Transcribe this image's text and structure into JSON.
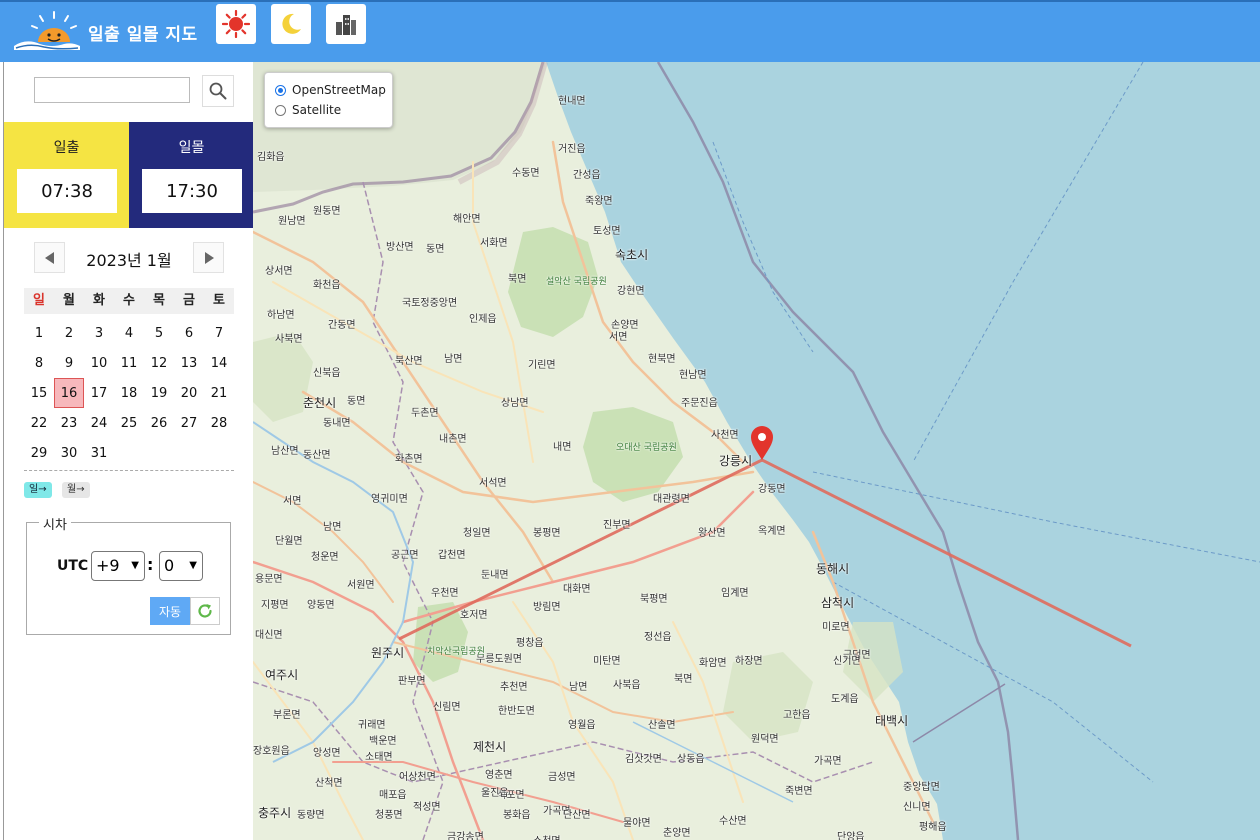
{
  "app": {
    "title": "일출 일몰 지도"
  },
  "header": {
    "icons": [
      "sun-icon",
      "moon-icon",
      "buildings-icon"
    ]
  },
  "search": {
    "placeholder": ""
  },
  "sun": {
    "sunrise_label": "일출",
    "sunrise_time": "07:38",
    "sunset_label": "일몰",
    "sunset_time": "17:30"
  },
  "calendar": {
    "month_title": "2023년 1월",
    "weekdays": [
      "일",
      "월",
      "화",
      "수",
      "목",
      "금",
      "토"
    ],
    "leading_blanks": 0,
    "days": [
      1,
      2,
      3,
      4,
      5,
      6,
      7,
      8,
      9,
      10,
      11,
      12,
      13,
      14,
      15,
      16,
      17,
      18,
      19,
      20,
      21,
      22,
      23,
      24,
      25,
      26,
      27,
      28,
      29,
      30,
      31
    ],
    "selected_day": 16,
    "day_button": "일→",
    "month_button": "월→"
  },
  "timezone": {
    "legend": "시차",
    "utc_label": "UTC",
    "hour": "+9",
    "minute": "0",
    "colon": ":",
    "auto_label": "자동"
  },
  "map": {
    "layers": [
      {
        "label": "OpenStreetMap",
        "checked": true
      },
      {
        "label": "Satellite",
        "checked": false
      }
    ],
    "colors": {
      "land": "#e9efdd",
      "sea": "#aad3df",
      "line": "#e06c5e",
      "marker": "#e2342c"
    },
    "labels": [
      "현내면",
      "거진읍",
      "김화읍",
      "수동면",
      "간성읍",
      "죽왕면",
      "해안면",
      "원남면",
      "원동면",
      "토성면",
      "방산면",
      "동면",
      "서화면",
      "속초시",
      "상서면",
      "북면",
      "설악산 국립공원",
      "강현면",
      "화천읍",
      "하남면",
      "국토정중앙면",
      "인제읍",
      "손양면",
      "간동면",
      "사북면",
      "서면",
      "북산면",
      "남면",
      "기린면",
      "현북면",
      "신북읍",
      "현남면",
      "춘천시",
      "동면",
      "상남면",
      "주문진읍",
      "두촌면",
      "동내면",
      "내촌면",
      "사천면",
      "남산면",
      "동산면",
      "화촌면",
      "내면",
      "오대산 국립공원",
      "강릉시",
      "서석면",
      "대관령면",
      "강동면",
      "서면",
      "영귀미면",
      "청일면",
      "봉평면",
      "진부면",
      "왕산면",
      "옥계면",
      "남면",
      "단월면",
      "청운면",
      "공근면",
      "갑천면",
      "둔내면",
      "동해시",
      "용문면",
      "서원면",
      "우천면",
      "대화면",
      "북평면",
      "임계면",
      "삼척시",
      "지평면",
      "양동면",
      "호저면",
      "방림면",
      "대신면",
      "정선읍",
      "미로면",
      "원주시",
      "평창읍",
      "무릉도원면",
      "미탄면",
      "근덕면",
      "여주시",
      "치악산국립공원",
      "화암면",
      "하장면",
      "신기면",
      "판부면",
      "추천면",
      "북면",
      "남면",
      "사북읍",
      "도계읍",
      "부론면",
      "신림면",
      "한반도면",
      "귀래면",
      "영월읍",
      "산솔면",
      "고한읍",
      "원덕면",
      "태백시",
      "백운면",
      "제천시",
      "장호원읍",
      "앙성면",
      "소태면",
      "김삿갓면",
      "상동읍",
      "가곡면",
      "산척면",
      "어상천면",
      "영춘면",
      "금성면",
      "석포면",
      "죽변면",
      "중앙탑면",
      "매포읍",
      "울진읍",
      "가곡면",
      "신니면",
      "충주시",
      "동량면",
      "청풍면",
      "적성면",
      "봉화읍",
      "단산면",
      "물야면",
      "춘양면",
      "수산면",
      "금강송면",
      "단양읍",
      "소천면",
      "평해읍"
    ]
  }
}
